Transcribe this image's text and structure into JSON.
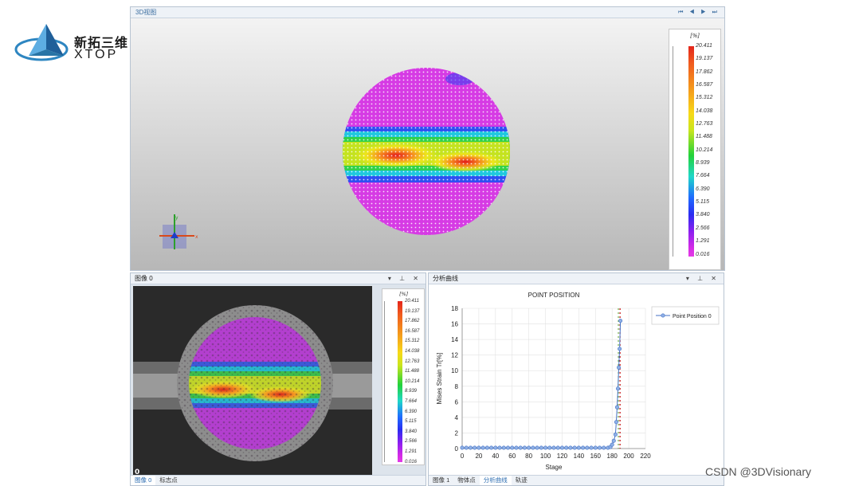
{
  "logo": {
    "cn": "新拓三维",
    "en": "XTOP"
  },
  "panel3d": {
    "title": "3D视图",
    "nav": "⏮ ◀ ▶ ⏭"
  },
  "legend": {
    "unit": "[%]",
    "values": [
      "20.411",
      "19.137",
      "17.862",
      "16.587",
      "15.312",
      "14.038",
      "12.763",
      "11.488",
      "10.214",
      "8.939",
      "7.664",
      "6.390",
      "5.115",
      "3.840",
      "2.566",
      "1.291",
      "0.016"
    ]
  },
  "image_panel": {
    "title": "图像 0",
    "controls": "▾ ⊥ ✕",
    "frame_label": "0",
    "tabs": [
      "图像 0",
      "标志点"
    ]
  },
  "chart_panel": {
    "title": "分析曲线",
    "controls": "▾ ⊥ ✕",
    "tabs": [
      "图像 1",
      "物体点",
      "分析曲线",
      "轨迹"
    ]
  },
  "axis_marker": {
    "y": "y",
    "x": "x"
  },
  "watermark": "CSDN @3DVisionary",
  "chart_data": {
    "type": "line",
    "title": "POINT POSITION",
    "xlabel": "Stage",
    "ylabel": "Mises Strain Tr[%]",
    "xlim": [
      0,
      220
    ],
    "ylim": [
      0,
      18
    ],
    "xticks": [
      0,
      20,
      40,
      60,
      80,
      100,
      120,
      140,
      160,
      180,
      200,
      220
    ],
    "yticks": [
      0,
      2,
      4,
      6,
      8,
      10,
      12,
      14,
      16,
      18
    ],
    "series": [
      {
        "name": "Point Position 0",
        "color": "#4472c4",
        "x": [
          0,
          5,
          10,
          15,
          20,
          25,
          30,
          35,
          40,
          45,
          50,
          55,
          60,
          65,
          70,
          75,
          80,
          85,
          90,
          95,
          100,
          105,
          110,
          115,
          120,
          125,
          130,
          135,
          140,
          145,
          150,
          155,
          160,
          165,
          170,
          175,
          178,
          180,
          182,
          184,
          185,
          186,
          187,
          188,
          189,
          190
        ],
        "y": [
          0.1,
          0.1,
          0.1,
          0.1,
          0.1,
          0.1,
          0.1,
          0.1,
          0.1,
          0.1,
          0.1,
          0.1,
          0.1,
          0.1,
          0.1,
          0.1,
          0.1,
          0.1,
          0.1,
          0.1,
          0.1,
          0.1,
          0.1,
          0.1,
          0.1,
          0.1,
          0.1,
          0.1,
          0.1,
          0.1,
          0.1,
          0.1,
          0.1,
          0.1,
          0.1,
          0.1,
          0.2,
          0.5,
          1.0,
          1.8,
          3.4,
          5.3,
          7.7,
          10.4,
          12.8,
          16.4
        ]
      }
    ],
    "markers": [
      {
        "color": "#c00000",
        "x": 189.5
      },
      {
        "color": "#70ad47",
        "x": 187.5
      }
    ],
    "legend_position": "top-right",
    "grid": true
  }
}
